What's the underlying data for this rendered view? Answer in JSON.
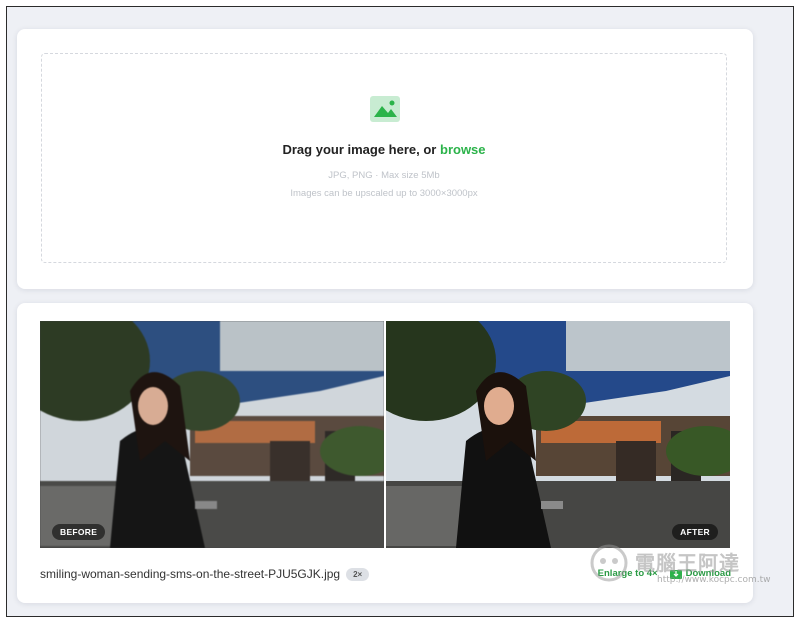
{
  "upload": {
    "drag_text": "Drag your image here, or",
    "browse_label": "browse",
    "formats_hint": "JPG, PNG · Max size 5Mb",
    "upscale_hint": "Images can be upscaled up to 3000×3000px"
  },
  "result": {
    "before_label": "BEFORE",
    "after_label": "AFTER",
    "filename": "smiling-woman-sending-sms-on-the-street-PJU5GJK.jpg",
    "scale_badge": "2×",
    "enlarge_label": "Enlarge to 4×",
    "download_label": "Download"
  },
  "watermark": {
    "text": "電腦王阿達",
    "url": "http://www.kocpc.com.tw"
  },
  "colors": {
    "accent_green": "#2bb34a",
    "background": "#eef0f5"
  },
  "icons": [
    "image-upload-icon",
    "download-icon"
  ]
}
